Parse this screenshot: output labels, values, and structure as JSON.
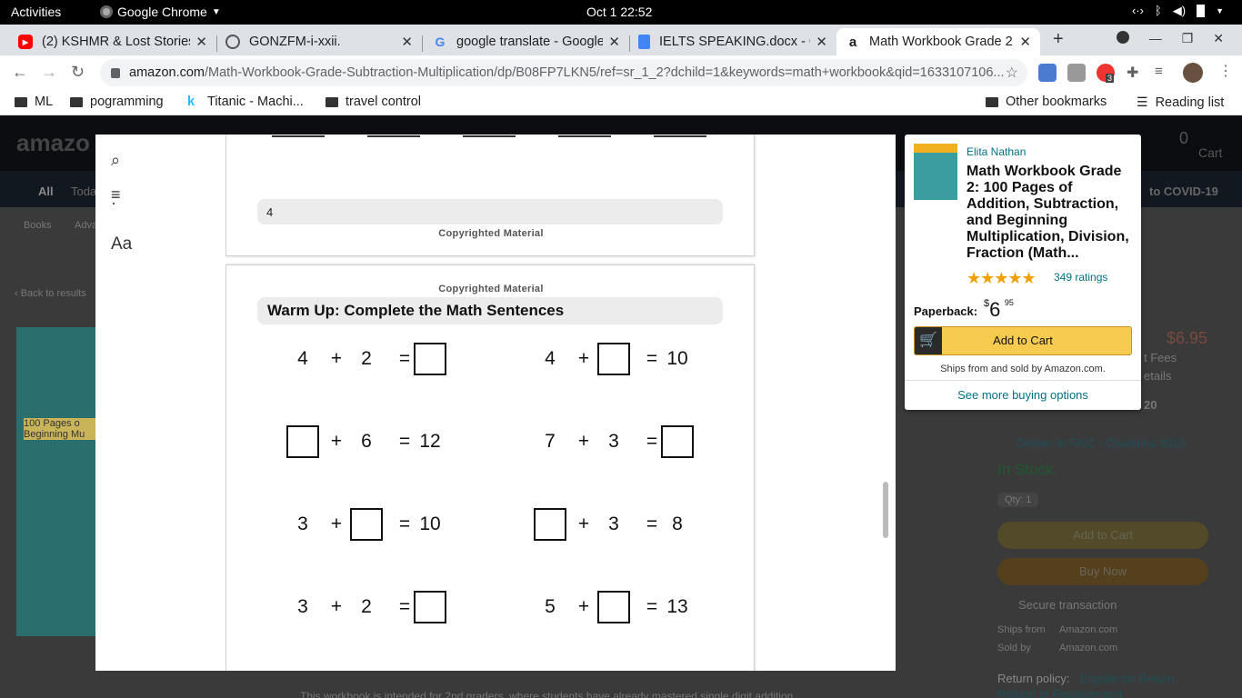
{
  "os": {
    "activities": "Activities",
    "app_name": "Google Chrome",
    "clock": "Oct 1  22:52"
  },
  "tabs": [
    {
      "title": "(2) KSHMR & Lost Stories",
      "icon": "youtube-icon"
    },
    {
      "title": "GONZFM-i-xxii.",
      "icon": "globe-icon"
    },
    {
      "title": "google translate - Google",
      "icon": "google-icon"
    },
    {
      "title": "IELTS SPEAKING.docx - G",
      "icon": "docs-icon"
    },
    {
      "title": "Math Workbook Grade 2",
      "icon": "amazon-icon"
    }
  ],
  "omnibox": {
    "host": "amazon.com",
    "path": "/Math-Workbook-Grade-Subtraction-Multiplication/dp/B08FP7LKN5/ref=sr_1_2?dchild=1&keywords=math+workbook&qid=1633107106..."
  },
  "extensions_badge": "3",
  "bookmarks": [
    {
      "label": "ML"
    },
    {
      "label": "pogramming"
    },
    {
      "label": "Titanic - Machi..."
    },
    {
      "label": "travel control"
    }
  ],
  "bookmarks_right": {
    "other": "Other bookmarks",
    "reading": "Reading list"
  },
  "amazon_bg": {
    "all": "All",
    "todays": "Toda",
    "covid": "to COVID-19",
    "books": "Books",
    "adv": "Adva",
    "back": "‹ Back to results",
    "cart": "Cart",
    "cart_count": "0",
    "side_price": "$6.95",
    "fees": "t Fees",
    "details": "etails",
    "date": "20",
    "deliver": "Deliver to FAIZ - Chandina 3510",
    "stock": "In Stock.",
    "qty": "Qty: 1",
    "add_to_cart": "Add to Cart",
    "buy_now": "Buy Now",
    "secure": "Secure transaction",
    "ships_from_label": "Ships from",
    "ships_from_value": "Amazon.com",
    "sold_by_label": "Sold by",
    "sold_by_value": "Amazon.com",
    "return_policy": "Return policy:",
    "return_link": "Eligible for Return,",
    "refund": "Refund or Replacement",
    "bottom_text": "This workbook is intended for 2nd graders, where students have already mastered single digit addition",
    "cover_text": "100 Pages o Beginning Mu"
  },
  "reader": {
    "search": "search-icon",
    "toc": "toc-icon",
    "font_label": "Aa",
    "page1": {
      "number": "4",
      "copyright": "Copyrighted Material"
    },
    "page2": {
      "copyright": "Copyrighted Material",
      "heading": "Warm Up: Complete the Math Sentences",
      "equations": [
        [
          {
            "a": "4",
            "op": "+",
            "b": "2",
            "eq": "=",
            "r": ""
          },
          {
            "a": "4",
            "op": "+",
            "b": "",
            "eq": "=",
            "r": "10"
          }
        ],
        [
          {
            "a": "",
            "op": "+",
            "b": "6",
            "eq": "=",
            "r": "12"
          },
          {
            "a": "7",
            "op": "+",
            "b": "3",
            "eq": "=",
            "r": ""
          }
        ],
        [
          {
            "a": "3",
            "op": "+",
            "b": "",
            "eq": "=",
            "r": "10"
          },
          {
            "a": "",
            "op": "+",
            "b": "3",
            "eq": "=",
            "r": "8"
          }
        ],
        [
          {
            "a": "3",
            "op": "+",
            "b": "2",
            "eq": "=",
            "r": ""
          },
          {
            "a": "5",
            "op": "+",
            "b": "",
            "eq": "=",
            "r": "13"
          }
        ]
      ]
    }
  },
  "popover": {
    "author": "Elita Nathan",
    "title": "Math Workbook Grade 2: 100 Pages of Addition, Subtraction, and Beginning Multiplication, Division, Fraction (Math...",
    "stars": "★★★★★",
    "rating_fraction": 0.9,
    "ratings": "349 ratings",
    "format": "Paperback:",
    "price_currency": "$",
    "price_whole": "6",
    "price_fraction": "95",
    "add_to_cart": "Add to Cart",
    "ships": "Ships from and sold by Amazon.com.",
    "see_more": "See more buying options"
  }
}
